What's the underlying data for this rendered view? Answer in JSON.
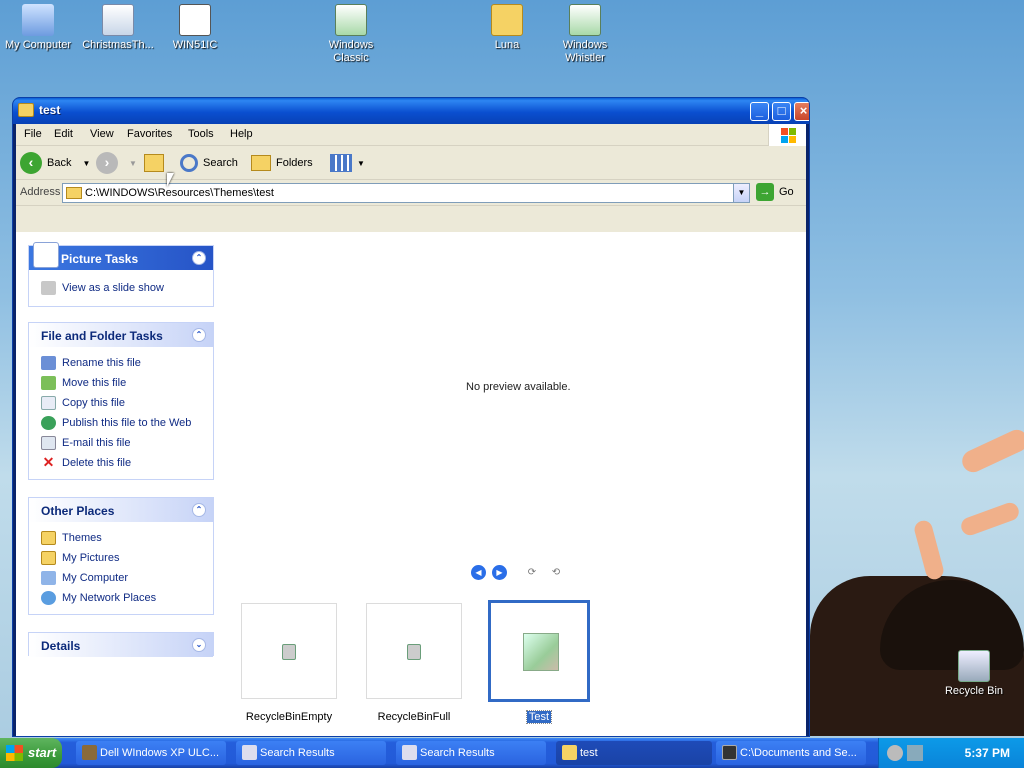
{
  "desktop": {
    "icons": [
      {
        "label": "My Computer",
        "icon": "my-computer-icon"
      },
      {
        "label": "ChristmasTh...",
        "icon": "file-icon"
      },
      {
        "label": "WIN51IC",
        "icon": "text-file-icon"
      },
      {
        "label": "Windows Classic",
        "icon": "theme-file-icon"
      },
      {
        "label": "Luna",
        "icon": "folder-icon"
      },
      {
        "label": "Windows Whistler",
        "icon": "theme-file-icon"
      },
      {
        "label": "Recycle Bin",
        "icon": "recycle-bin-icon"
      }
    ]
  },
  "window": {
    "title": "test",
    "menu": [
      "File",
      "Edit",
      "View",
      "Favorites",
      "Tools",
      "Help"
    ],
    "toolbar": {
      "back": "Back",
      "search": "Search",
      "folders": "Folders"
    },
    "address": {
      "label": "Address",
      "value": "C:\\WINDOWS\\Resources\\Themes\\test",
      "go": "Go"
    },
    "tasks": {
      "picture": {
        "title": "Picture Tasks",
        "items": [
          "View as a slide show"
        ]
      },
      "file_folder": {
        "title": "File and Folder Tasks",
        "items": [
          "Rename this file",
          "Move this file",
          "Copy this file",
          "Publish this file to the Web",
          "E-mail this file",
          "Delete this file"
        ]
      },
      "other": {
        "title": "Other Places",
        "items": [
          "Themes",
          "My Pictures",
          "My Computer",
          "My Network Places"
        ]
      },
      "details": {
        "title": "Details"
      }
    },
    "preview": {
      "message": "No preview available."
    },
    "files": [
      {
        "name": "RecycleBinEmpty",
        "selected": false
      },
      {
        "name": "RecycleBinFull",
        "selected": false
      },
      {
        "name": "Test",
        "selected": true
      }
    ]
  },
  "taskbar": {
    "start": "start",
    "buttons": [
      {
        "label": "Dell WIndows XP ULC..."
      },
      {
        "label": "Search Results"
      },
      {
        "label": "Search Results"
      },
      {
        "label": "test",
        "active": true
      },
      {
        "label": "C:\\Documents and Se..."
      }
    ],
    "clock": "5:37 PM"
  }
}
